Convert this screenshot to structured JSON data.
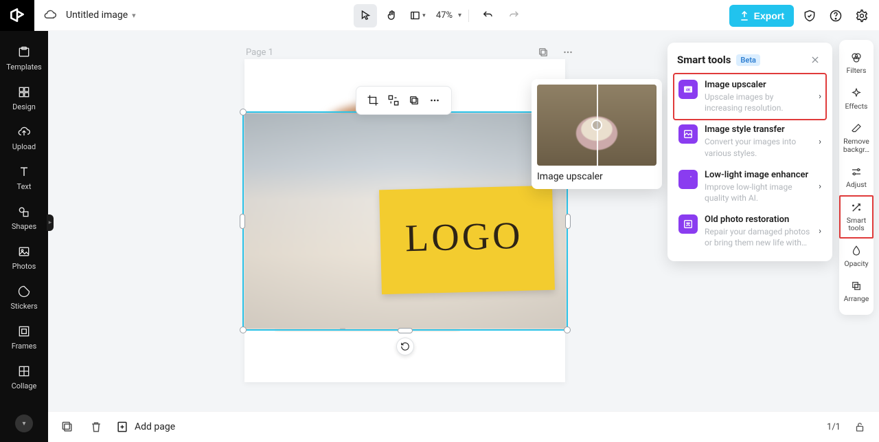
{
  "header": {
    "title": "Untitled image",
    "zoom": "47%",
    "export_label": "Export"
  },
  "left_sidebar": {
    "items": [
      {
        "label": "Templates"
      },
      {
        "label": "Design"
      },
      {
        "label": "Upload"
      },
      {
        "label": "Text"
      },
      {
        "label": "Shapes"
      },
      {
        "label": "Photos"
      },
      {
        "label": "Stickers"
      },
      {
        "label": "Frames"
      },
      {
        "label": "Collage"
      }
    ]
  },
  "canvas": {
    "page_label": "Page 1",
    "card_text": "LOGO"
  },
  "popout": {
    "label": "Image upscaler"
  },
  "smart_tools": {
    "title": "Smart tools",
    "badge": "Beta",
    "items": [
      {
        "title": "Image upscaler",
        "desc": "Upscale images by increasing resolution."
      },
      {
        "title": "Image style transfer",
        "desc": "Convert your images into various styles."
      },
      {
        "title": "Low-light image enhancer",
        "desc": "Improve low-light image quality with AI."
      },
      {
        "title": "Old photo restoration",
        "desc": "Repair your damaged photos or bring them new life with…"
      }
    ]
  },
  "right_sidebar": {
    "items": [
      {
        "label": "Filters"
      },
      {
        "label": "Effects"
      },
      {
        "label": "Remove backgr…"
      },
      {
        "label": "Adjust"
      },
      {
        "label": "Smart tools"
      },
      {
        "label": "Opacity"
      },
      {
        "label": "Arrange"
      }
    ]
  },
  "bottombar": {
    "add_page": "Add page",
    "page_count": "1/1"
  }
}
